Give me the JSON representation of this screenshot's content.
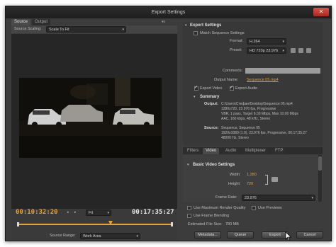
{
  "window": {
    "title": "Export Settings",
    "close_glyph": "✕"
  },
  "tabs": {
    "source": "Source",
    "output": "Output",
    "panel_menu": "▾≡"
  },
  "source_scaling": {
    "label": "Source Scaling:",
    "value": "Scale To Fit"
  },
  "export_settings": {
    "heading": "Export Settings",
    "match_sequence": "Match Sequence Settings",
    "format_label": "Format:",
    "format_value": "H.264",
    "preset_label": "Preset:",
    "preset_value": "HD 720p 23.976",
    "comments_label": "Comments:",
    "comments_value": "",
    "output_name_label": "Output Name:",
    "output_name_value": "Sequence 05.mp4",
    "export_video": "Export Video",
    "export_audio": "Export Audio"
  },
  "summary": {
    "heading": "Summary",
    "output_label": "Output:",
    "output_lines": [
      "C:\\Users\\Стефан\\Desktop\\Sequence 05.mp4",
      "1280x720, 23.976 fps, Progressive",
      "VBR, 1 pass, Target 6.00 Mbps, Max 10.00 Mbps",
      "AAC, 160 kbps, 48 kHz, Stereo"
    ],
    "source_label": "Source:",
    "source_lines": [
      "Sequence, Sequence 05",
      "1920x1080 (1.0), 23.976 fps, Progressive, 00;17;35;27",
      "48000 Hz, Stereo"
    ]
  },
  "subtabs": [
    "Filters",
    "Video",
    "Audio",
    "Multiplexer",
    "FTP"
  ],
  "basic_video": {
    "heading": "Basic Video Settings",
    "width_label": "Width:",
    "width_value": "1,280",
    "height_label": "Height:",
    "height_value": "720",
    "frame_rate_label": "Frame Rate:",
    "frame_rate_value": "23.976"
  },
  "options": {
    "max_render": "Use Maximum Render Quality",
    "use_previews": "Use Previews",
    "frame_blending": "Use Frame Blending",
    "file_size_label": "Estimated File Size:",
    "file_size_value": "780 MB"
  },
  "buttons": {
    "metadata": "Metadata...",
    "queue": "Queue",
    "export": "Export",
    "cancel": "Cancel"
  },
  "timeline": {
    "current_time": "00:10:32:20",
    "duration": "00:17:35:27",
    "fit_value": "Fit",
    "progress": 0.6,
    "source_range_label": "Source Range:",
    "source_range_value": "Work Area"
  },
  "colors": {
    "timecode": "#e8a13a",
    "accent": "#e79a35",
    "window_bg": "#3c3c3c"
  }
}
